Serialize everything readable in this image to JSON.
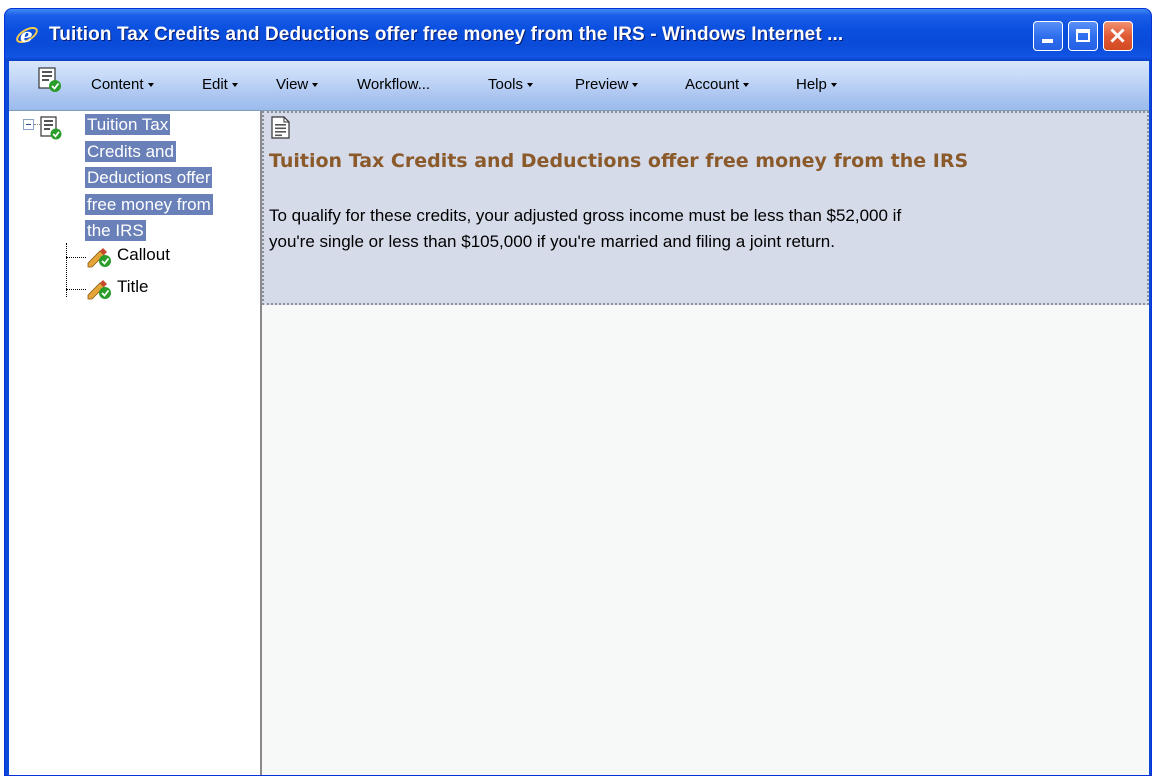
{
  "window": {
    "title": "Tuition Tax Credits and Deductions offer free money from the IRS - Windows Internet ...",
    "controls": [
      "minimize",
      "maximize",
      "close"
    ]
  },
  "menubar": {
    "items": [
      {
        "label": "Content",
        "has_dropdown": true
      },
      {
        "label": "Edit",
        "has_dropdown": true
      },
      {
        "label": "View",
        "has_dropdown": true
      },
      {
        "label": "Workflow...",
        "has_dropdown": false
      },
      {
        "label": "Tools",
        "has_dropdown": true
      },
      {
        "label": "Preview",
        "has_dropdown": true
      },
      {
        "label": "Account",
        "has_dropdown": true
      },
      {
        "label": "Help",
        "has_dropdown": true
      }
    ]
  },
  "tree": {
    "root": {
      "label_lines": [
        "Tuition Tax",
        "Credits and",
        "Deductions offer",
        "free money from",
        "the IRS"
      ],
      "selected": true,
      "expanded": true,
      "icon": "document-check-icon"
    },
    "children": [
      {
        "label": "Callout",
        "icon": "edit-check-icon"
      },
      {
        "label": "Title",
        "icon": "edit-check-icon"
      }
    ]
  },
  "editor": {
    "icon": "document-icon",
    "title": "Tuition Tax Credits and Deductions offer free money from the IRS",
    "body_lines": [
      "To qualify for these credits, your adjusted gross income must be less than $52,000 if",
      "you're single or less than $105,000 if you're married and filing a joint return."
    ]
  },
  "colors": {
    "titlebar": "#0a4fe0",
    "menubar": "#c4d8f7",
    "selection": "#6a80b8",
    "editor_bg": "#d6dbe9",
    "editor_title": "#8b5a2b"
  }
}
